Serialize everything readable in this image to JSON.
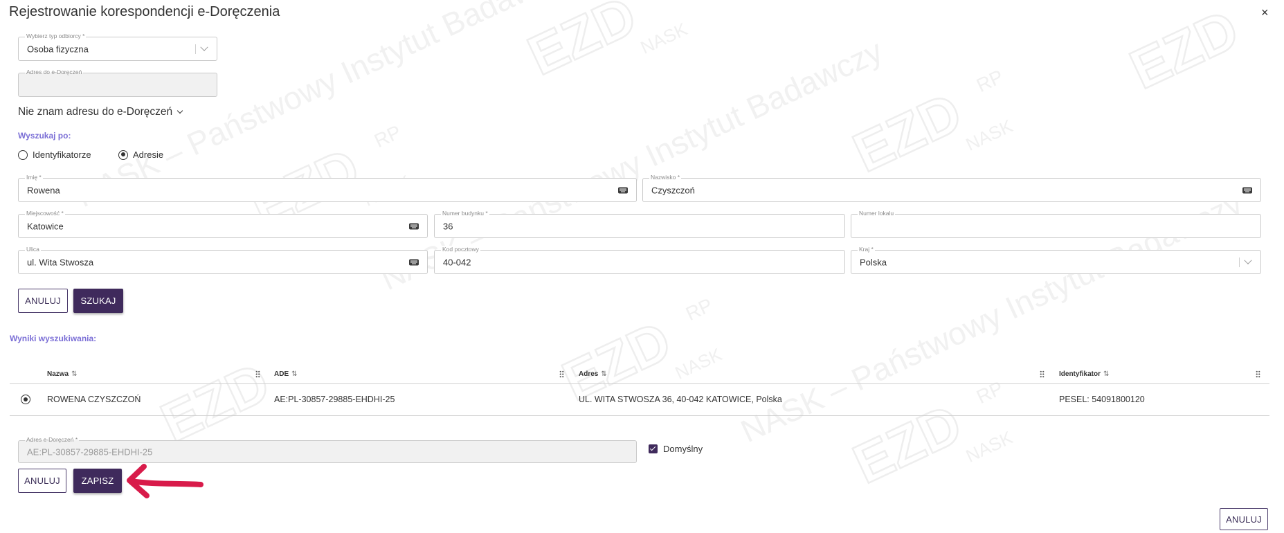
{
  "dialog": {
    "title": "Rejestrowanie korespondencji e-Doręczenia",
    "close_label": "×"
  },
  "recipient_type": {
    "label": "Wybierz typ odbiorcy *",
    "value": "Osoba fizyczna"
  },
  "address_field": {
    "label": "Adres do e-Doręczeń",
    "value": ""
  },
  "unknown_address_toggle": "Nie znam adresu do e-Doręczeń",
  "search_by": {
    "label": "Wyszukaj po:",
    "options": [
      {
        "label": "Identyfikatorze",
        "selected": false
      },
      {
        "label": "Adresie",
        "selected": true
      }
    ]
  },
  "form": {
    "first_name": {
      "label": "Imię *",
      "value": "Rowena"
    },
    "last_name": {
      "label": "Nazwisko *",
      "value": "Czyszczoń"
    },
    "city": {
      "label": "Miejscowość *",
      "value": "Katowice"
    },
    "building_number": {
      "label": "Numer budynku *",
      "value": "36"
    },
    "apartment_number": {
      "label": "Numer lokalu",
      "value": ""
    },
    "street": {
      "label": "Ulica",
      "value": "ul. Wita Stwosza"
    },
    "postal_code": {
      "label": "Kod pocztowy",
      "value": "40-042"
    },
    "country": {
      "label": "Kraj *",
      "value": "Polska"
    }
  },
  "search_buttons": {
    "cancel": "ANULUJ",
    "search": "SZUKAJ"
  },
  "results": {
    "label": "Wyniki wyszukiwania:",
    "columns": [
      "Nazwa",
      "ADE",
      "Adres",
      "Identyfikator"
    ],
    "sort_icon": "⇅",
    "rows": [
      {
        "selected": true,
        "name": "ROWENA CZYSZCZOŃ",
        "ade": "AE:PL-30857-29885-EHDHI-25",
        "address": "UL. WITA STWOSZA 36, 40-042 KATOWICE, Polska",
        "identifier": "PESEL: 54091800120"
      }
    ]
  },
  "ede_address": {
    "label": "Adres e-Doręczeń *",
    "value": "AE:PL-30857-29885-EHDHI-25"
  },
  "default_checkbox": {
    "label": "Domyślny",
    "checked": true
  },
  "save_buttons": {
    "cancel": "ANULUJ",
    "save": "ZAPISZ"
  },
  "footer": {
    "cancel": "ANULUJ"
  },
  "watermark": {
    "brand": "EZD",
    "superscript": "RP",
    "org": "NASK",
    "text": "NASK – Państwowy Instytut Badawczy"
  },
  "colors": {
    "primary": "#3f2a5c",
    "accent_label": "#7b6fd6",
    "arrow": "#d81b4a"
  }
}
